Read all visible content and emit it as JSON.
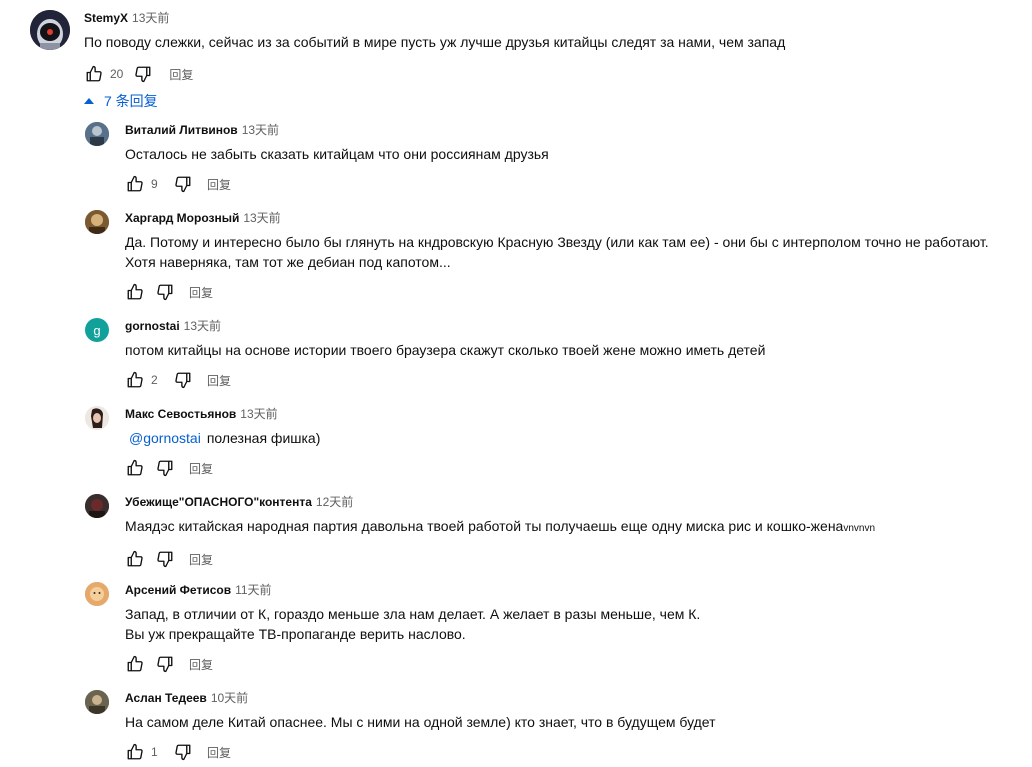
{
  "top_comment": {
    "author": "StemyX",
    "time": "13天前",
    "text": "По поводу слежки, сейчас из за событий в мире пусть уж лучше друзья китайцы следят за нами, чем запад",
    "likes": "20",
    "reply_label": "回复"
  },
  "replies_toggle": {
    "label": "7 条回复",
    "icon": "caret-up-icon",
    "color": "#065fd4"
  },
  "replies": [
    {
      "author": "Виталий Литвинов",
      "time": "13天前",
      "text": "Осталось не забыть сказать китайцам что они россиянам друзья",
      "text2": "",
      "likes": "9",
      "reply_label": "回复"
    },
    {
      "author": "Харгард Морозный",
      "time": "13天前",
      "text": "Да. Потому и интересно было бы глянуть на кндровскую Красную Звезду (или как там ее) - они бы с интерполом точно не работают.",
      "text2": "Хотя наверняка, там тот же дебиан под капотом...",
      "likes": "",
      "reply_label": "回复"
    },
    {
      "author": "gornostai",
      "time": "13天前",
      "text": "потом китайцы на основе истории твоего браузера скажут сколько твоей жене можно иметь детей",
      "text2": "",
      "likes": "2",
      "reply_label": "回复",
      "avatar_letter": "g"
    },
    {
      "author": "Макс Севостьянов",
      "time": "13天前",
      "mention": "@gornostai",
      "text": "полезная фишка)",
      "text2": "",
      "likes": "",
      "reply_label": "回复"
    },
    {
      "author": "Убежище\"ОПАСНОГО\"контента",
      "time": "12天前",
      "text": "Маядэс китайская народная партия давольна твоей работой ты получаешь еще одну миска рис и кошко-жена",
      "text_small": "vnvnvn",
      "text2": "",
      "likes": "",
      "reply_label": "回复"
    },
    {
      "author": "Арсений Фетисов",
      "time": "11天前",
      "text": "Запад, в отличии от К, гораздо меньше зла нам делает. А желает в разы меньше, чем К.",
      "text2": "Вы уж прекращайте ТВ-пропаганде верить наслово.",
      "likes": "",
      "reply_label": "回复"
    },
    {
      "author": "Аслан Тедеев",
      "time": "10天前",
      "text": "На самом деле Китай опаснее. Мы с ними на одной земле) кто знает, что в будущем будет",
      "text2": "",
      "likes": "1",
      "reply_label": "回复"
    }
  ],
  "colors": {
    "link": "#065fd4",
    "muted": "#606060",
    "text": "#0f0f0f",
    "gornostai_avatar": "#12a19a"
  }
}
